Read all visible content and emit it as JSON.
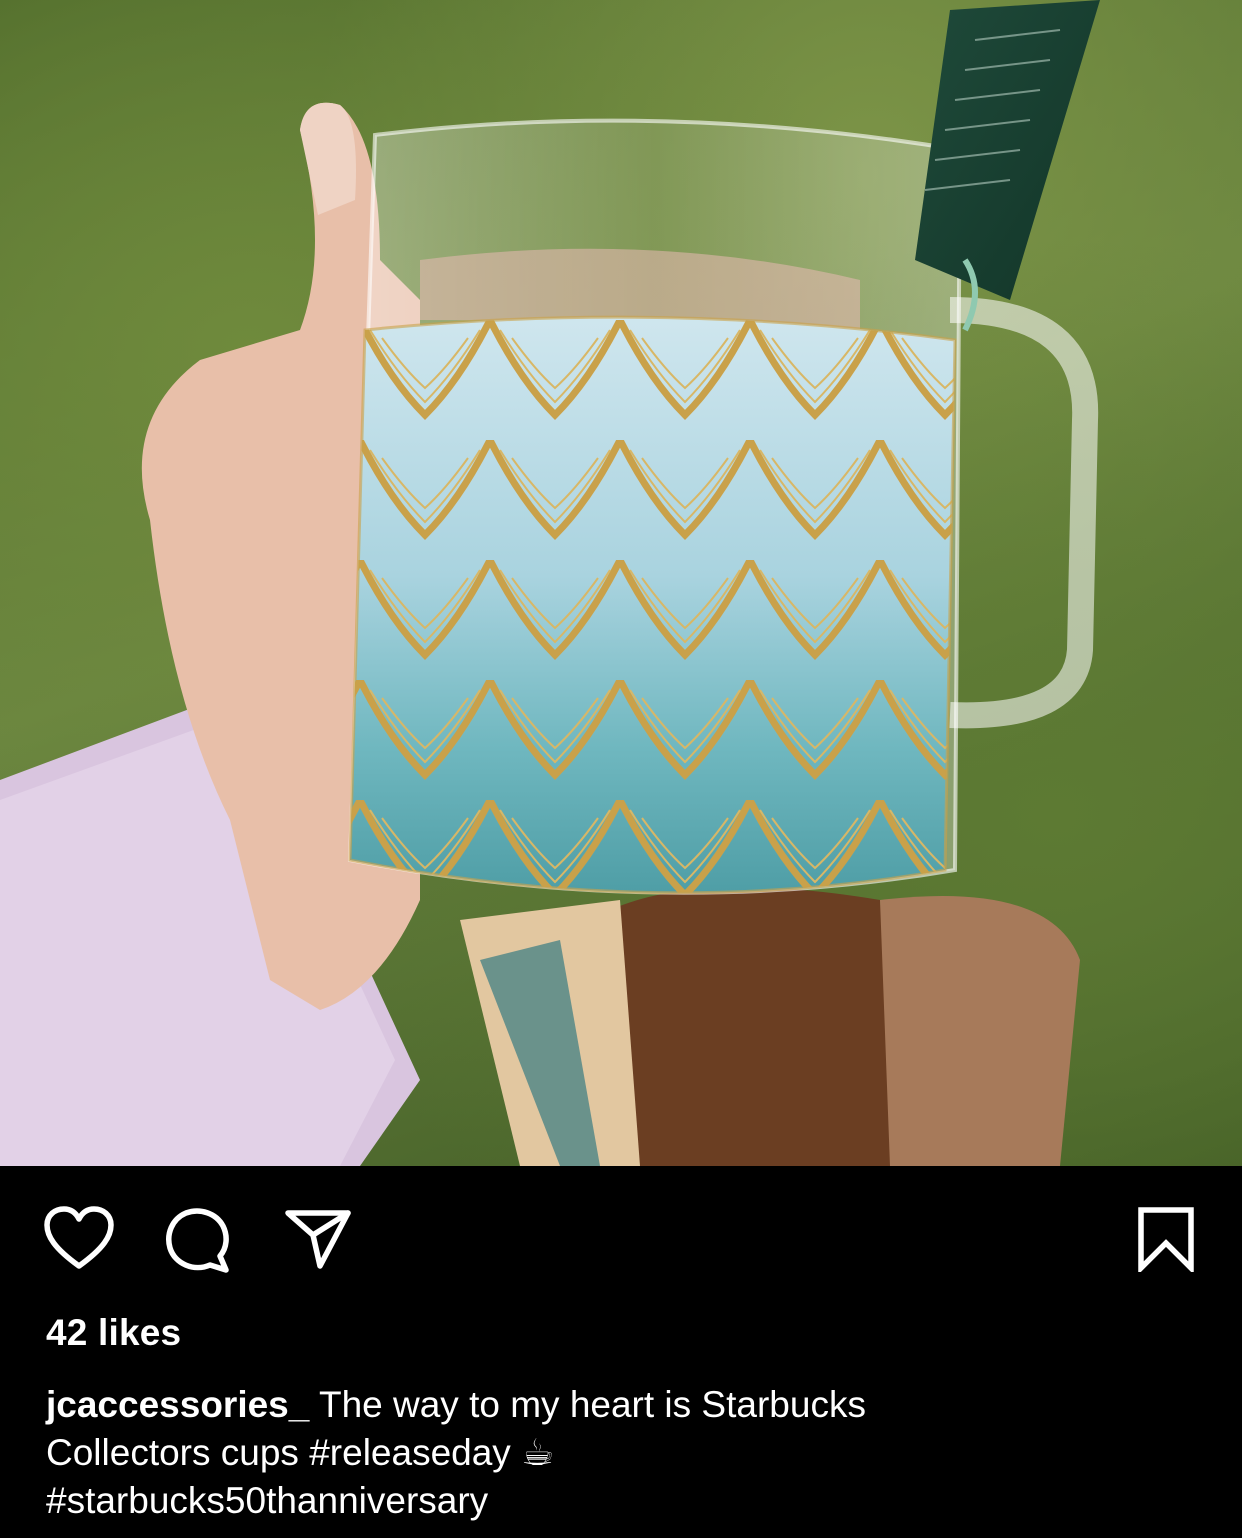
{
  "post": {
    "image_alt": "Hand holding a glass Starbucks collectors mug with gold-outlined teal scale pattern over grass",
    "likes_text": "42 likes",
    "caption": {
      "username": "jcaccessories_",
      "text_line1": "The way to my heart is Starbucks",
      "text_line2_prefix": "Collectors cups ",
      "hashtag1": "#releaseday",
      "emoji": "☕",
      "hashtag2": "#starbucks50thanniversary"
    }
  },
  "actions": {
    "like_icon": "heart-icon",
    "comment_icon": "comment-icon",
    "share_icon": "paper-plane-icon",
    "save_icon": "bookmark-icon"
  },
  "colors": {
    "background": "#000000",
    "text": "#ffffff"
  }
}
